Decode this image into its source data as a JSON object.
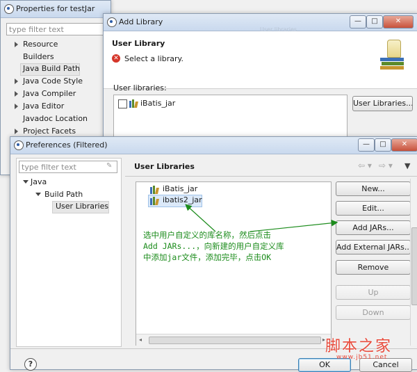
{
  "properties_window": {
    "title": "Properties for testJar",
    "filter_placeholder": "type filter text",
    "tree": [
      "Resource",
      "Builders",
      "Java Build Path",
      "Java Code Style",
      "Java Compiler",
      "Java Editor",
      "Javadoc Location",
      "Project Facets"
    ]
  },
  "add_library_window": {
    "title": "Add Library",
    "subtitle_faded": "User libraries",
    "heading": "User Library",
    "message": "Select a library.",
    "libraries_label": "User libraries:",
    "libraries": [
      "iBatis_jar"
    ],
    "user_libraries_button": "User Libraries..."
  },
  "preferences_window": {
    "title": "Preferences (Filtered)",
    "filter_placeholder": "type filter text",
    "tree": {
      "java": "Java",
      "build_path": "Build Path",
      "user_libraries": "User Libraries"
    },
    "page_title": "User Libraries",
    "libraries": [
      "iBatis_jar",
      "ibatis2_jar"
    ],
    "buttons": {
      "new": "New...",
      "edit": "Edit...",
      "add_jars": "Add JARs...",
      "add_external_jars": "Add External JARs...",
      "remove": "Remove",
      "up": "Up",
      "down": "Down",
      "ok": "OK",
      "cancel": "Cancel"
    },
    "help_glyph": "?"
  },
  "annotation": {
    "line1": "选中用户自定义的库名称，然后点击",
    "line2": "Add JARs...，向新建的用户自定义库",
    "line3": "中添加jar文件，添加完毕，点击OK",
    "color": "#1c8c1c"
  },
  "watermark": {
    "main": "脚本之家",
    "url": "www.jb51.net"
  },
  "icons": {
    "error": "error-icon",
    "jar": "jar-library-icon",
    "library_banner": "library-jars-icon",
    "clear_filter": "clear-filter-icon"
  }
}
